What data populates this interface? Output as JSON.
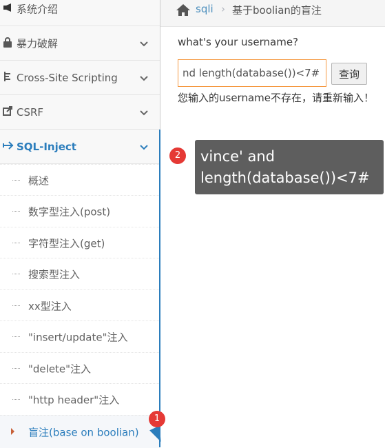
{
  "sidebar": {
    "menus": [
      {
        "label": "系统介绍",
        "icon": "bullhorn-icon"
      },
      {
        "label": "暴力破解",
        "icon": "lock-icon"
      },
      {
        "label": "Cross-Site Scripting",
        "icon": "tree-icon"
      },
      {
        "label": "CSRF",
        "icon": "share-icon"
      },
      {
        "label": "SQL-Inject",
        "icon": "plane-icon"
      }
    ],
    "sub_items": [
      {
        "label": "概述"
      },
      {
        "label": "数字型注入(post)"
      },
      {
        "label": "字符型注入(get)"
      },
      {
        "label": "搜索型注入"
      },
      {
        "label": "xx型注入"
      },
      {
        "label": "\"insert/update\"注入"
      },
      {
        "label": "\"delete\"注入"
      },
      {
        "label": "\"http header\"注入"
      },
      {
        "label": "盲注(base on boolian)"
      }
    ]
  },
  "breadcrumb": {
    "home_icon": "home-icon",
    "crumb1": "sqli",
    "separator": "›",
    "crumb2": "基于boolian的盲注"
  },
  "form": {
    "question": "what's your username?",
    "input_value": "nd length(database())<7#",
    "submit_label": "查询",
    "result_message": "您输入的username不存在，请重新输入！"
  },
  "annotations": {
    "badge1": "1",
    "badge2": "2",
    "tooltip_line1": "vince' and",
    "tooltip_line2": "length(database())<7#"
  },
  "colors": {
    "accent": "#2b7dbc",
    "badge": "#e53935",
    "tooltip_bg": "#5e5e5e",
    "input_border": "#f59942"
  }
}
